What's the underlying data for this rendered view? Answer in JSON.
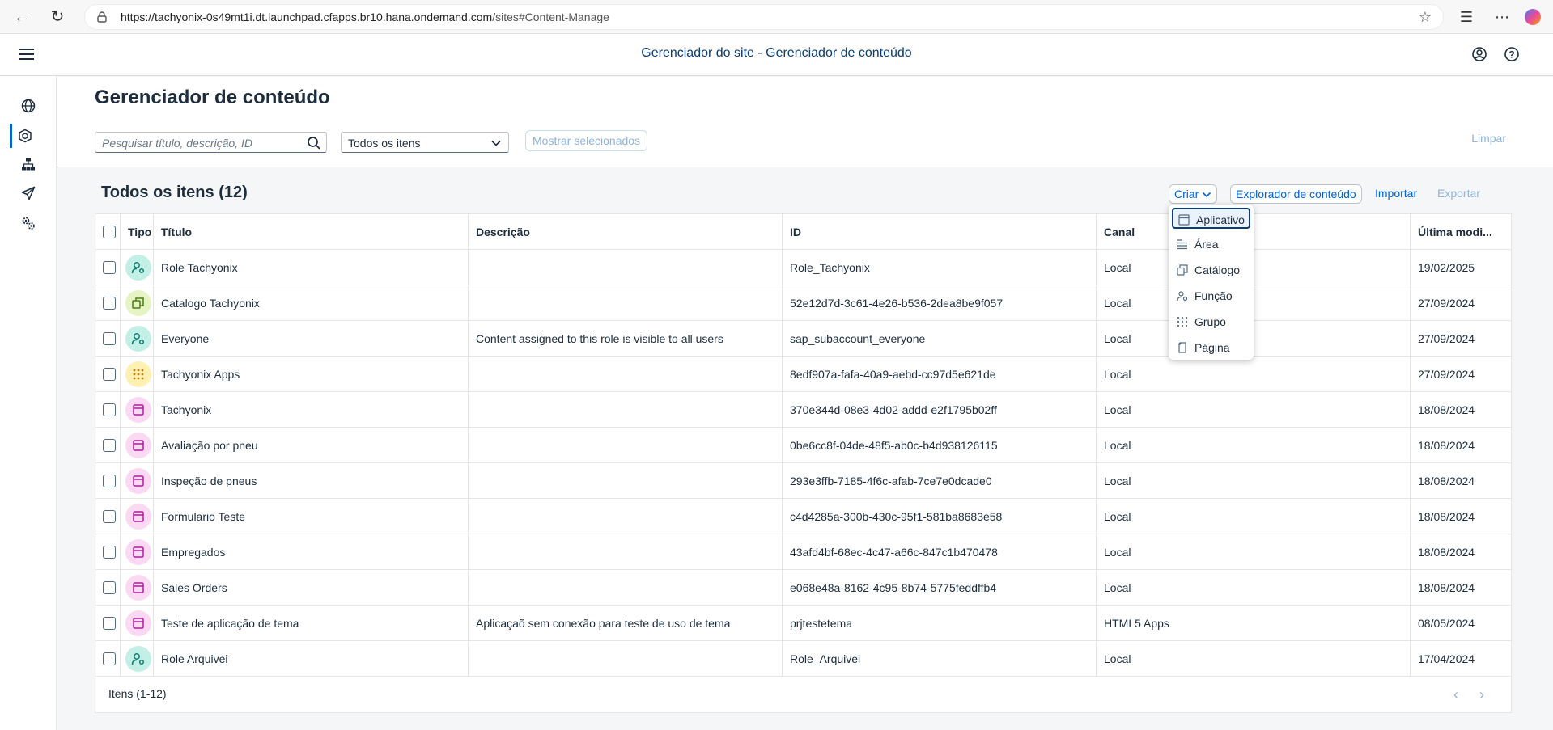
{
  "browser": {
    "url_host": "https://tachyonix-0s49mt1i.dt.launchpad.cfapps.br10.hana.ondemand.com",
    "url_path": "/sites#Content-Manage"
  },
  "shell": {
    "title": "Gerenciador do site - Gerenciador de conteúdo"
  },
  "page": {
    "title": "Gerenciador de conteúdo",
    "search_placeholder": "Pesquisar título, descrição, ID",
    "filter_value": "Todos os itens",
    "show_selected_label": "Mostrar selecionados",
    "clear_label": "Limpar"
  },
  "table": {
    "title": "Todos os itens (12)",
    "toolbar": {
      "create": "Criar",
      "explorer": "Explorador de conteúdo",
      "import": "Importar",
      "export": "Exportar"
    },
    "columns": {
      "type": "Tipo",
      "title": "Título",
      "description": "Descrição",
      "id": "ID",
      "channel": "Canal",
      "modified": "Última modi..."
    },
    "rows": [
      {
        "kind": "role",
        "title": "Role Tachyonix",
        "description": "",
        "id": "Role_Tachyonix",
        "channel": "Local",
        "modified": "19/02/2025"
      },
      {
        "kind": "catalog",
        "title": "Catalogo Tachyonix",
        "description": "",
        "id": "52e12d7d-3c61-4e26-b536-2dea8be9f057",
        "channel": "Local",
        "modified": "27/09/2024"
      },
      {
        "kind": "role",
        "title": "Everyone",
        "description": "Content assigned to this role is visible to all users",
        "id": "sap_subaccount_everyone",
        "channel": "Local",
        "modified": "27/09/2024"
      },
      {
        "kind": "group",
        "title": "Tachyonix Apps",
        "description": "",
        "id": "8edf907a-fafa-40a9-aebd-cc97d5e621de",
        "channel": "Local",
        "modified": "27/09/2024"
      },
      {
        "kind": "app",
        "title": "Tachyonix",
        "description": "",
        "id": "370e344d-08e3-4d02-addd-e2f1795b02ff",
        "channel": "Local",
        "modified": "18/08/2024"
      },
      {
        "kind": "app",
        "title": "Avaliação por pneu",
        "description": "",
        "id": "0be6cc8f-04de-48f5-ab0c-b4d938126115",
        "channel": "Local",
        "modified": "18/08/2024"
      },
      {
        "kind": "app",
        "title": "Inspeção de pneus",
        "description": "",
        "id": "293e3ffb-7185-4f6c-afab-7ce7e0dcade0",
        "channel": "Local",
        "modified": "18/08/2024"
      },
      {
        "kind": "app",
        "title": "Formulario Teste",
        "description": "",
        "id": "c4d4285a-300b-430c-95f1-581ba8683e58",
        "channel": "Local",
        "modified": "18/08/2024"
      },
      {
        "kind": "app",
        "title": "Empregados",
        "description": "",
        "id": "43afd4bf-68ec-4c47-a66c-847c1b470478",
        "channel": "Local",
        "modified": "18/08/2024"
      },
      {
        "kind": "app",
        "title": "Sales Orders",
        "description": "",
        "id": "e068e48a-8162-4c95-8b74-5775feddffb4",
        "channel": "Local",
        "modified": "18/08/2024"
      },
      {
        "kind": "app",
        "title": "Teste de aplicação de tema",
        "description": "Aplicaçaõ sem conexão para teste de uso de tema",
        "id": "prjtestetema",
        "channel": "HTML5 Apps",
        "modified": "08/05/2024"
      },
      {
        "kind": "role",
        "title": "Role Arquivei",
        "description": "",
        "id": "Role_Arquivei",
        "channel": "Local",
        "modified": "17/04/2024"
      }
    ],
    "footer": "Itens (1-12)"
  },
  "create_menu": {
    "items": [
      "Aplicativo",
      "Área",
      "Catálogo",
      "Função",
      "Grupo",
      "Página"
    ]
  },
  "colors": {
    "role_bg": "#c2f0e6",
    "role_fg": "#0f7d6e",
    "catalog_bg": "#e6f3c2",
    "catalog_fg": "#4a7a12",
    "group_bg": "#fff0b3",
    "group_fg": "#c87b00",
    "app_bg": "#fbd9f3",
    "app_fg": "#b01c9c",
    "accent": "#0064d9"
  }
}
